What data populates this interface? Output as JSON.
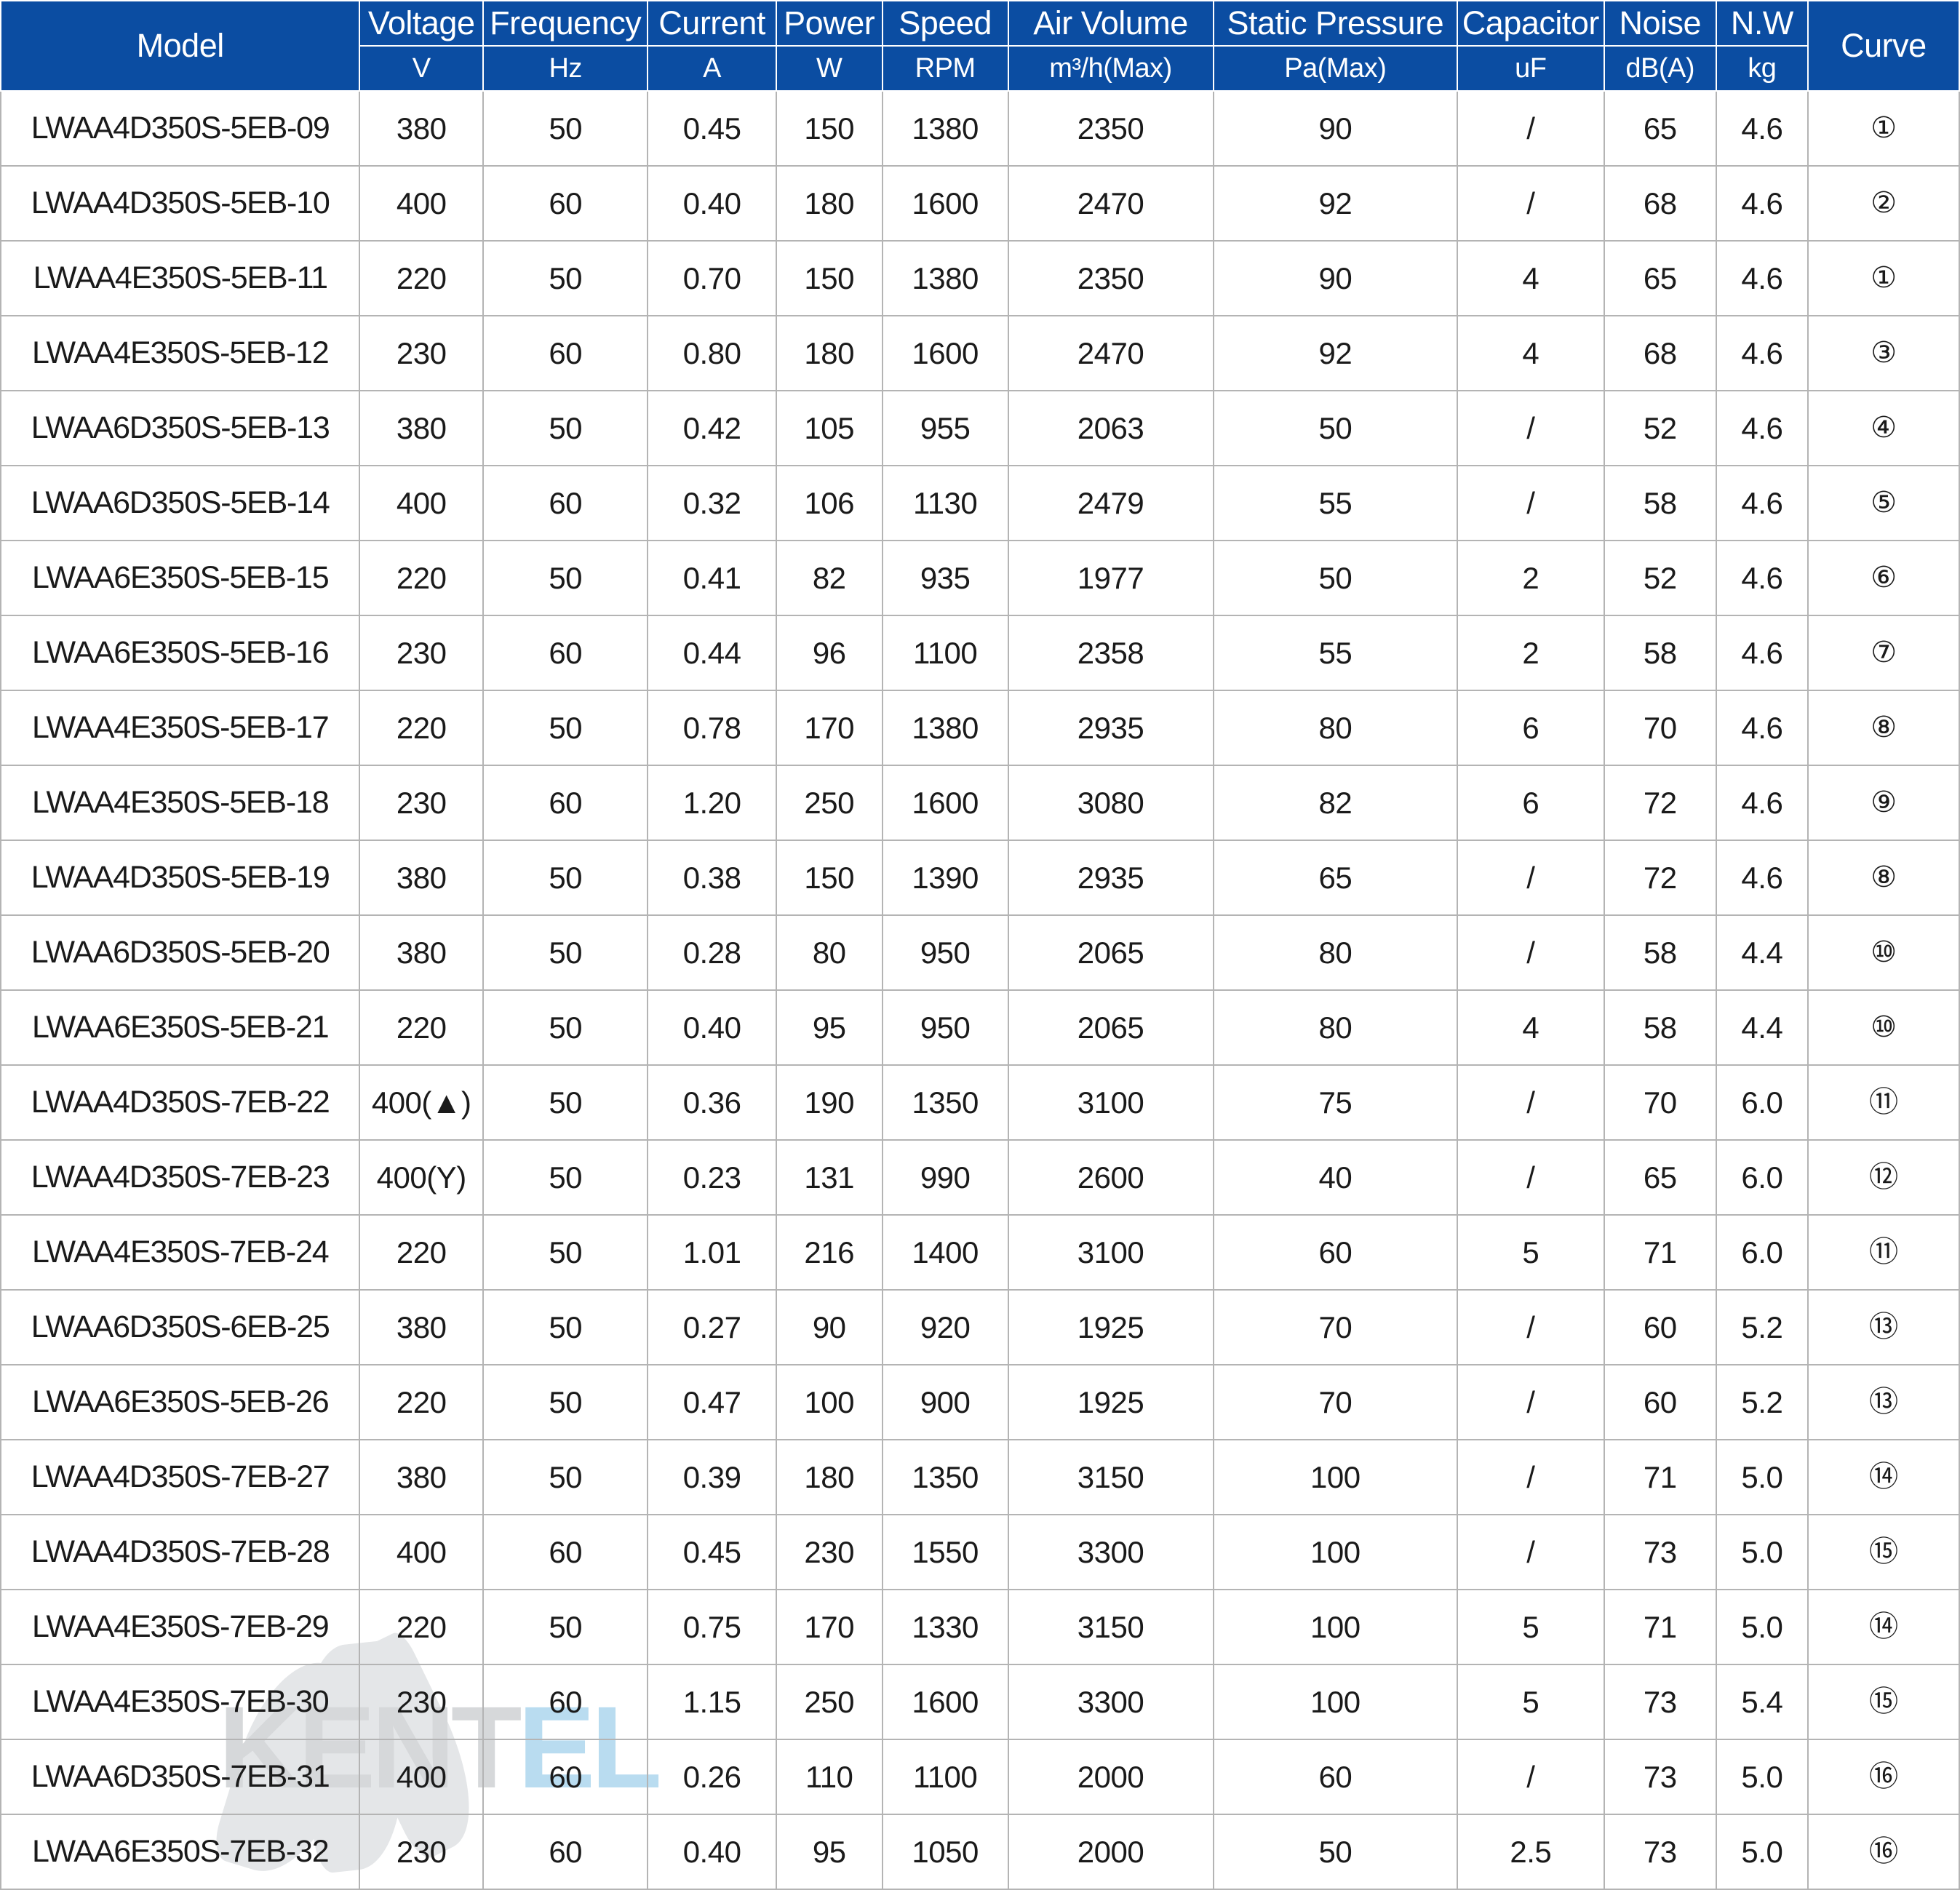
{
  "table": {
    "headers": {
      "model": "Model",
      "voltage": "Voltage",
      "frequency": "Frequency",
      "current": "Current",
      "power": "Power",
      "speed": "Speed",
      "air_volume": "Air Volume",
      "static_pressure": "Static Pressure",
      "capacitor": "Capacitor",
      "noise": "Noise",
      "nw": "N.W",
      "curve": "Curve"
    },
    "units": {
      "voltage": "V",
      "frequency": "Hz",
      "current": "A",
      "power": "W",
      "speed": "RPM",
      "air_volume": "m³/h(Max)",
      "static_pressure": "Pa(Max)",
      "capacitor": "uF",
      "noise": "dB(A)",
      "nw": "kg"
    },
    "rows": [
      {
        "model": "LWAA4D350S-5EB-09",
        "voltage": "380",
        "frequency": "50",
        "current": "0.45",
        "power": "150",
        "speed": "1380",
        "air_volume": "2350",
        "static_pressure": "90",
        "capacitor": "/",
        "noise": "65",
        "nw": "4.6",
        "curve": "①"
      },
      {
        "model": "LWAA4D350S-5EB-10",
        "voltage": "400",
        "frequency": "60",
        "current": "0.40",
        "power": "180",
        "speed": "1600",
        "air_volume": "2470",
        "static_pressure": "92",
        "capacitor": "/",
        "noise": "68",
        "nw": "4.6",
        "curve": "②"
      },
      {
        "model": "LWAA4E350S-5EB-11",
        "voltage": "220",
        "frequency": "50",
        "current": "0.70",
        "power": "150",
        "speed": "1380",
        "air_volume": "2350",
        "static_pressure": "90",
        "capacitor": "4",
        "noise": "65",
        "nw": "4.6",
        "curve": "①"
      },
      {
        "model": "LWAA4E350S-5EB-12",
        "voltage": "230",
        "frequency": "60",
        "current": "0.80",
        "power": "180",
        "speed": "1600",
        "air_volume": "2470",
        "static_pressure": "92",
        "capacitor": "4",
        "noise": "68",
        "nw": "4.6",
        "curve": "③"
      },
      {
        "model": "LWAA6D350S-5EB-13",
        "voltage": "380",
        "frequency": "50",
        "current": "0.42",
        "power": "105",
        "speed": "955",
        "air_volume": "2063",
        "static_pressure": "50",
        "capacitor": "/",
        "noise": "52",
        "nw": "4.6",
        "curve": "④"
      },
      {
        "model": "LWAA6D350S-5EB-14",
        "voltage": "400",
        "frequency": "60",
        "current": "0.32",
        "power": "106",
        "speed": "1130",
        "air_volume": "2479",
        "static_pressure": "55",
        "capacitor": "/",
        "noise": "58",
        "nw": "4.6",
        "curve": "⑤"
      },
      {
        "model": "LWAA6E350S-5EB-15",
        "voltage": "220",
        "frequency": "50",
        "current": "0.41",
        "power": "82",
        "speed": "935",
        "air_volume": "1977",
        "static_pressure": "50",
        "capacitor": "2",
        "noise": "52",
        "nw": "4.6",
        "curve": "⑥"
      },
      {
        "model": "LWAA6E350S-5EB-16",
        "voltage": "230",
        "frequency": "60",
        "current": "0.44",
        "power": "96",
        "speed": "1100",
        "air_volume": "2358",
        "static_pressure": "55",
        "capacitor": "2",
        "noise": "58",
        "nw": "4.6",
        "curve": "⑦"
      },
      {
        "model": "LWAA4E350S-5EB-17",
        "voltage": "220",
        "frequency": "50",
        "current": "0.78",
        "power": "170",
        "speed": "1380",
        "air_volume": "2935",
        "static_pressure": "80",
        "capacitor": "6",
        "noise": "70",
        "nw": "4.6",
        "curve": "⑧"
      },
      {
        "model": "LWAA4E350S-5EB-18",
        "voltage": "230",
        "frequency": "60",
        "current": "1.20",
        "power": "250",
        "speed": "1600",
        "air_volume": "3080",
        "static_pressure": "82",
        "capacitor": "6",
        "noise": "72",
        "nw": "4.6",
        "curve": "⑨"
      },
      {
        "model": "LWAA4D350S-5EB-19",
        "voltage": "380",
        "frequency": "50",
        "current": "0.38",
        "power": "150",
        "speed": "1390",
        "air_volume": "2935",
        "static_pressure": "65",
        "capacitor": "/",
        "noise": "72",
        "nw": "4.6",
        "curve": "⑧"
      },
      {
        "model": "LWAA6D350S-5EB-20",
        "voltage": "380",
        "frequency": "50",
        "current": "0.28",
        "power": "80",
        "speed": "950",
        "air_volume": "2065",
        "static_pressure": "80",
        "capacitor": "/",
        "noise": "58",
        "nw": "4.4",
        "curve": "⑩"
      },
      {
        "model": "LWAA6E350S-5EB-21",
        "voltage": "220",
        "frequency": "50",
        "current": "0.40",
        "power": "95",
        "speed": "950",
        "air_volume": "2065",
        "static_pressure": "80",
        "capacitor": "4",
        "noise": "58",
        "nw": "4.4",
        "curve": "⑩"
      },
      {
        "model": "LWAA4D350S-7EB-22",
        "voltage": "400(▲)",
        "frequency": "50",
        "current": "0.36",
        "power": "190",
        "speed": "1350",
        "air_volume": "3100",
        "static_pressure": "75",
        "capacitor": "/",
        "noise": "70",
        "nw": "6.0",
        "curve": "⑪"
      },
      {
        "model": "LWAA4D350S-7EB-23",
        "voltage": "400(Y)",
        "frequency": "50",
        "current": "0.23",
        "power": "131",
        "speed": "990",
        "air_volume": "2600",
        "static_pressure": "40",
        "capacitor": "/",
        "noise": "65",
        "nw": "6.0",
        "curve": "⑫"
      },
      {
        "model": "LWAA4E350S-7EB-24",
        "voltage": "220",
        "frequency": "50",
        "current": "1.01",
        "power": "216",
        "speed": "1400",
        "air_volume": "3100",
        "static_pressure": "60",
        "capacitor": "5",
        "noise": "71",
        "nw": "6.0",
        "curve": "⑪"
      },
      {
        "model": "LWAA6D350S-6EB-25",
        "voltage": "380",
        "frequency": "50",
        "current": "0.27",
        "power": "90",
        "speed": "920",
        "air_volume": "1925",
        "static_pressure": "70",
        "capacitor": "/",
        "noise": "60",
        "nw": "5.2",
        "curve": "⑬"
      },
      {
        "model": "LWAA6E350S-5EB-26",
        "voltage": "220",
        "frequency": "50",
        "current": "0.47",
        "power": "100",
        "speed": "900",
        "air_volume": "1925",
        "static_pressure": "70",
        "capacitor": "/",
        "noise": "60",
        "nw": "5.2",
        "curve": "⑬"
      },
      {
        "model": "LWAA4D350S-7EB-27",
        "voltage": "380",
        "frequency": "50",
        "current": "0.39",
        "power": "180",
        "speed": "1350",
        "air_volume": "3150",
        "static_pressure": "100",
        "capacitor": "/",
        "noise": "71",
        "nw": "5.0",
        "curve": "⑭"
      },
      {
        "model": "LWAA4D350S-7EB-28",
        "voltage": "400",
        "frequency": "60",
        "current": "0.45",
        "power": "230",
        "speed": "1550",
        "air_volume": "3300",
        "static_pressure": "100",
        "capacitor": "/",
        "noise": "73",
        "nw": "5.0",
        "curve": "⑮"
      },
      {
        "model": "LWAA4E350S-7EB-29",
        "voltage": "220",
        "frequency": "50",
        "current": "0.75",
        "power": "170",
        "speed": "1330",
        "air_volume": "3150",
        "static_pressure": "100",
        "capacitor": "5",
        "noise": "71",
        "nw": "5.0",
        "curve": "⑭"
      },
      {
        "model": "LWAA4E350S-7EB-30",
        "voltage": "230",
        "frequency": "60",
        "current": "1.15",
        "power": "250",
        "speed": "1600",
        "air_volume": "3300",
        "static_pressure": "100",
        "capacitor": "5",
        "noise": "73",
        "nw": "5.4",
        "curve": "⑮"
      },
      {
        "model": "LWAA6D350S-7EB-31",
        "voltage": "400",
        "frequency": "60",
        "current": "0.26",
        "power": "110",
        "speed": "1100",
        "air_volume": "2000",
        "static_pressure": "60",
        "capacitor": "/",
        "noise": "73",
        "nw": "5.0",
        "curve": "⑯"
      },
      {
        "model": "LWAA6E350S-7EB-32",
        "voltage": "230",
        "frequency": "60",
        "current": "0.40",
        "power": "95",
        "speed": "1050",
        "air_volume": "2000",
        "static_pressure": "50",
        "capacitor": "2.5",
        "noise": "73",
        "nw": "5.0",
        "curve": "⑯"
      }
    ]
  },
  "watermark": {
    "text_primary": "KENT",
    "text_secondary": "EL",
    "color_primary": "#d6d8da",
    "color_secondary": "#b9dcf0"
  },
  "colors": {
    "header_background": "#0b4da2",
    "header_text": "#ffffff",
    "grid_line": "#b4b4b4",
    "body_text": "#1a1a1a"
  }
}
